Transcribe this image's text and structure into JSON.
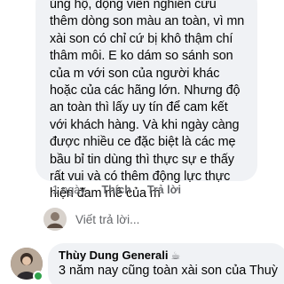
{
  "comment": {
    "lines": [
      "ủng hộ, động viên nghiên cứu",
      "thêm dòng son màu an toàn, vì mn",
      "xài son có chỉ cứ bị khô thậm chí",
      "thâm môi. E ko dám so sánh son",
      "của m với son của người khác",
      "hoặc của các hãng lớn. Nhưng độ",
      "an toàn thì lấy uy tín để cam kết",
      "với khách hàng. Và khi ngày càng",
      "được nhiều ce đặc biệt là các mẹ",
      "bầu bỉ tin dùng thì thực sự e thấy",
      "rất vui và có thêm động lực thực",
      "hiện đam mê của m"
    ],
    "time": "1 ngày",
    "like_label": "Thích",
    "reply_label": "Trả lời"
  },
  "reply_box": {
    "placeholder": "Viết trả lời..."
  },
  "next_comment": {
    "author": "Thùy Dung Generali",
    "badge_icon": "coffee-icon",
    "text": "3 năm nay cũng toàn xài son của Thuỳ",
    "online": true
  },
  "colors": {
    "bubble_bg": "#f0f2f5",
    "secondary_text": "#65676b",
    "online": "#31a24c"
  }
}
